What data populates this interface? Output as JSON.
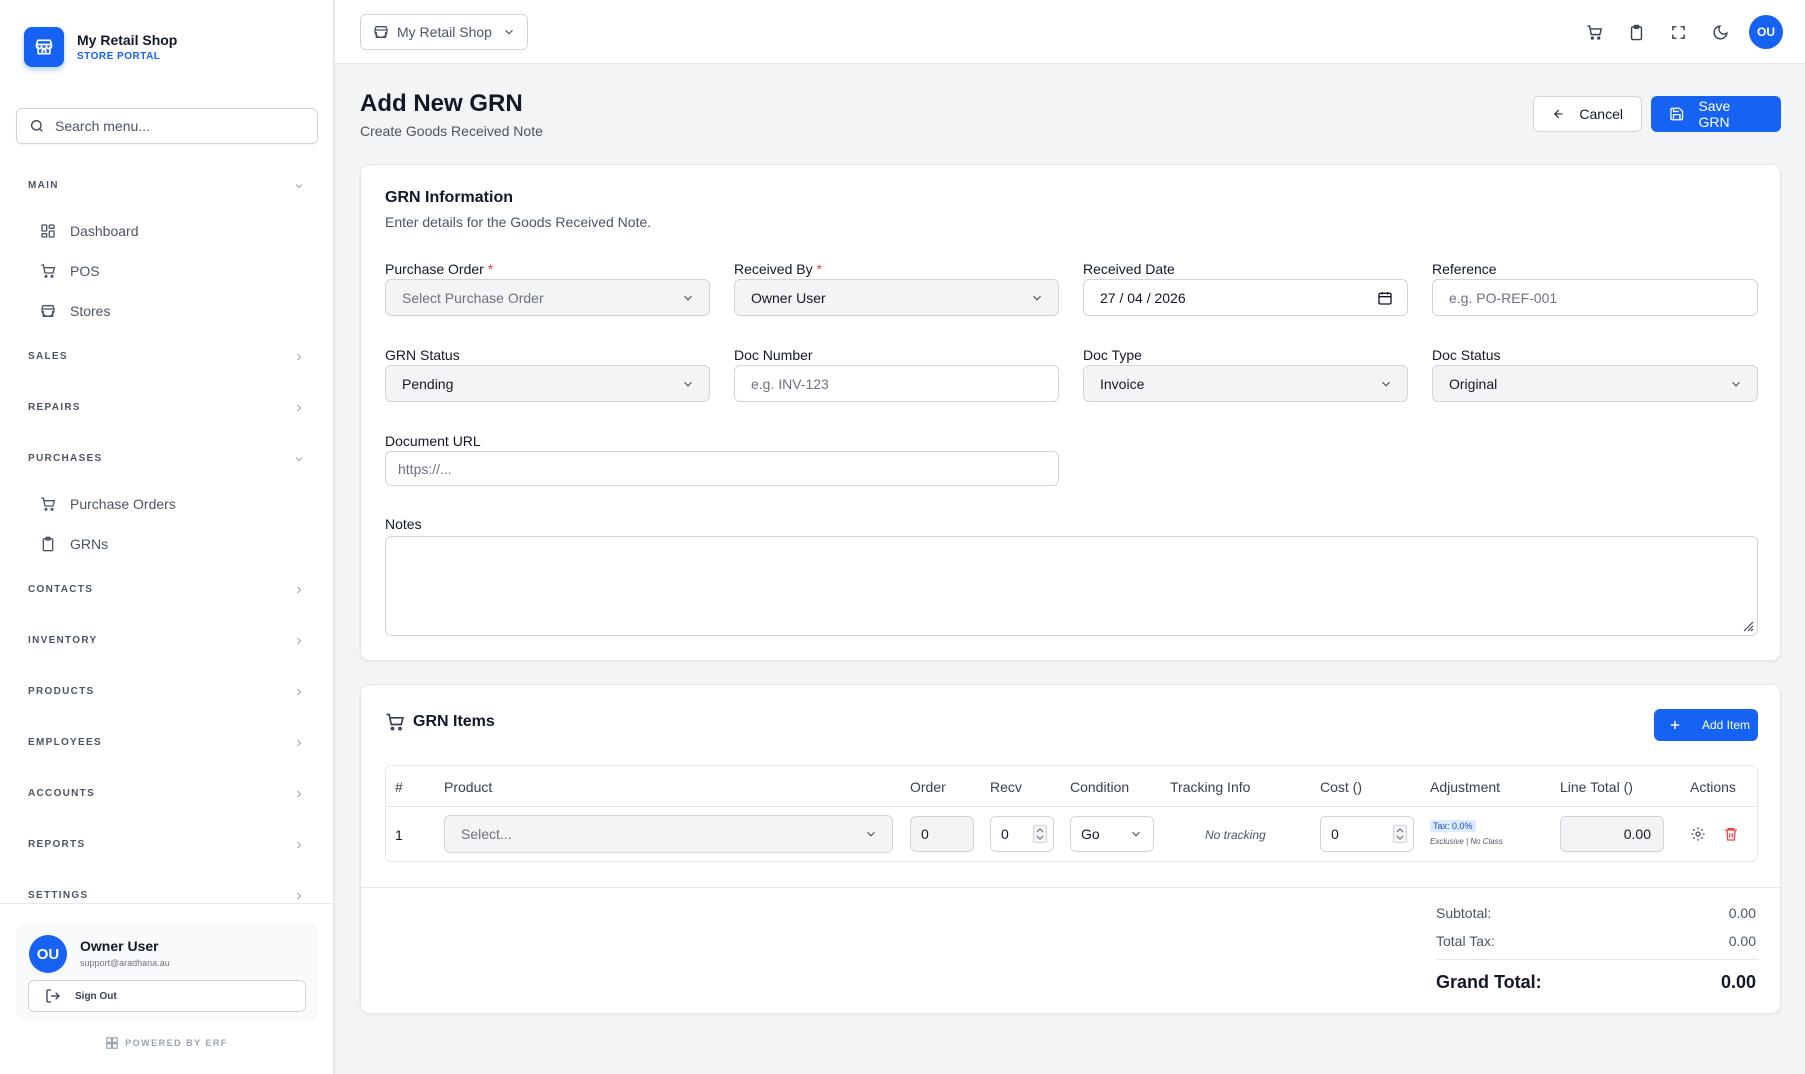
{
  "brand": {
    "name": "My Retail Shop",
    "subtitle": "STORE PORTAL"
  },
  "sidebar": {
    "search_placeholder": "Search menu...",
    "sections": [
      {
        "label": "MAIN",
        "expanded": true,
        "items": [
          {
            "label": "Dashboard",
            "icon": "grid-icon"
          },
          {
            "label": "POS",
            "icon": "cart-icon"
          },
          {
            "label": "Stores",
            "icon": "store-icon"
          }
        ]
      },
      {
        "label": "SALES",
        "expanded": false
      },
      {
        "label": "REPAIRS",
        "expanded": false
      },
      {
        "label": "PURCHASES",
        "expanded": true,
        "items": [
          {
            "label": "Purchase Orders",
            "icon": "cart-icon"
          },
          {
            "label": "GRNs",
            "icon": "clipboard-icon"
          }
        ]
      },
      {
        "label": "CONTACTS",
        "expanded": false
      },
      {
        "label": "INVENTORY",
        "expanded": false
      },
      {
        "label": "PRODUCTS",
        "expanded": false
      },
      {
        "label": "EMPLOYEES",
        "expanded": false
      },
      {
        "label": "ACCOUNTS",
        "expanded": false
      },
      {
        "label": "REPORTS",
        "expanded": false
      },
      {
        "label": "SETTINGS",
        "expanded": false
      }
    ],
    "user": {
      "initials": "OU",
      "name": "Owner User",
      "email": "support@aradhana.au"
    },
    "sign_out": "Sign Out",
    "powered_by": "POWERED BY ERF"
  },
  "topbar": {
    "store_selector": "My Retail Shop",
    "avatar_initials": "OU"
  },
  "page": {
    "title": "Add New GRN",
    "subtitle": "Create Goods Received Note",
    "cancel": "Cancel",
    "save": "Save GRN"
  },
  "grn_info": {
    "title": "GRN Information",
    "subtitle": "Enter details for the Goods Received Note.",
    "purchase_order": {
      "label": "Purchase Order",
      "placeholder": "Select Purchase Order"
    },
    "received_by": {
      "label": "Received By",
      "value": "Owner User"
    },
    "received_date": {
      "label": "Received Date",
      "value": "27 / 04 / 2026"
    },
    "reference": {
      "label": "Reference",
      "placeholder": "e.g. PO-REF-001"
    },
    "grn_status": {
      "label": "GRN Status",
      "value": "Pending"
    },
    "doc_number": {
      "label": "Doc Number",
      "placeholder": "e.g. INV-123"
    },
    "doc_type": {
      "label": "Doc Type",
      "value": "Invoice"
    },
    "doc_status": {
      "label": "Doc Status",
      "value": "Original"
    },
    "document_url": {
      "label": "Document URL",
      "placeholder": "https://..."
    },
    "notes": {
      "label": "Notes"
    }
  },
  "grn_items": {
    "title": "GRN Items",
    "add_item": "Add Item",
    "columns": [
      "#",
      "Product",
      "Order",
      "Recv",
      "Condition",
      "Tracking Info",
      "Cost ()",
      "Adjustment",
      "Line Total ()",
      "Actions"
    ],
    "rows": [
      {
        "num": "1",
        "product_placeholder": "Select...",
        "order": "0",
        "recv": "0",
        "condition": "Go",
        "tracking": "No tracking",
        "cost": "0",
        "tax": "Tax: 0.0%",
        "adjustment": "Exclusive | No Class",
        "line_total": "0.00"
      }
    ]
  },
  "totals": {
    "subtotal_label": "Subtotal:",
    "subtotal": "0.00",
    "tax_label": "Total Tax:",
    "tax": "0.00",
    "grand_label": "Grand Total:",
    "grand": "0.00"
  },
  "colors": {
    "accent": "#1663f3",
    "danger": "#ef4444"
  }
}
